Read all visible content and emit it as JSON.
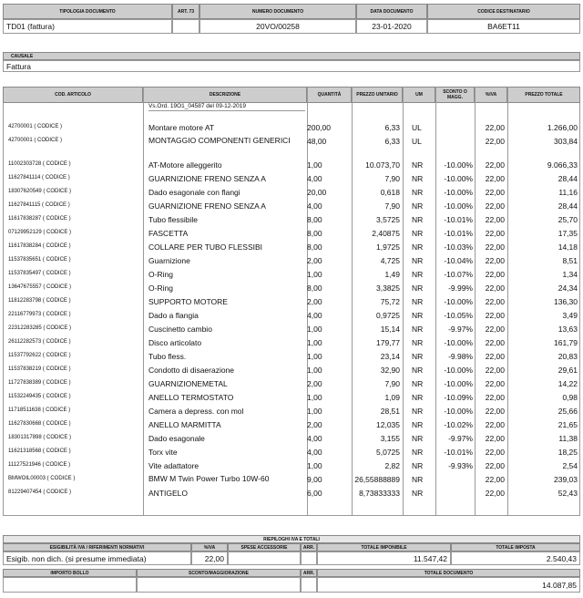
{
  "top_headers": {
    "tipologia": "TIPOLOGIA DOCUMENTO",
    "art": "ART. 73",
    "numero": "NUMERO DOCUMENTO",
    "data": "DATA DOCUMENTO",
    "codice_dest": "CODICE DESTINATARIO"
  },
  "top_values": {
    "tipologia": "TD01 (fattura)",
    "art": "",
    "numero": "20VO/00258",
    "data": "23-01-2020",
    "codice_dest": "BA6ET11"
  },
  "causale": {
    "label": "CAUSALE",
    "value": "Fattura"
  },
  "items_headers": {
    "cod": "COD. ARTICOLO",
    "descr": "DESCRIZIONE",
    "qty": "QUANTITÀ",
    "prezzo": "PREZZO UNITARIO",
    "um": "UM",
    "sconto": "SCONTO O MAGG.",
    "iva": "%IVA",
    "totale": "PREZZO TOTALE"
  },
  "order_ref": "Vs.Ord. 19O1_04587 del 09-12-2019",
  "items": [
    {
      "code": "42700001 ( CODICE )",
      "desc": "Montare motore AT",
      "qty": "200,00",
      "price": "6,33",
      "um": "UL",
      "disc": "",
      "iva": "22,00",
      "total": "1.266,00"
    },
    {
      "code": "42700001 ( CODICE )",
      "desc": "MONTAGGIO COMPONENTI GENERICI",
      "qty": "48,00",
      "price": "6,33",
      "um": "UL",
      "disc": "",
      "iva": "22,00",
      "total": "303,84"
    },
    {
      "code": "11002303728 ( CODICE )",
      "desc": "AT-Motore alleggerito",
      "qty": "1,00",
      "price": "10.073,70",
      "um": "NR",
      "disc": "-10.00%",
      "iva": "22,00",
      "total": "9.066,33"
    },
    {
      "code": "11627841114 ( CODICE )",
      "desc": "GUARNIZIONE FRENO SENZA A",
      "qty": "4,00",
      "price": "7,90",
      "um": "NR",
      "disc": "-10.00%",
      "iva": "22,00",
      "total": "28,44"
    },
    {
      "code": "18307620549 ( CODICE )",
      "desc": "Dado esagonale con flangi",
      "qty": "20,00",
      "price": "0,618",
      "um": "NR",
      "disc": "-10.00%",
      "iva": "22,00",
      "total": "11,16"
    },
    {
      "code": "11627841115 ( CODICE )",
      "desc": "GUARNIZIONE FRENO SENZA A",
      "qty": "4,00",
      "price": "7,90",
      "um": "NR",
      "disc": "-10.00%",
      "iva": "22,00",
      "total": "28,44"
    },
    {
      "code": "11617838287 ( CODICE )",
      "desc": "Tubo flessibile",
      "qty": "8,00",
      "price": "3,5725",
      "um": "NR",
      "disc": "-10.01%",
      "iva": "22,00",
      "total": "25,70"
    },
    {
      "code": "07129952129 ( CODICE )",
      "desc": "FASCETTA",
      "qty": "8,00",
      "price": "2,40875",
      "um": "NR",
      "disc": "-10.01%",
      "iva": "22,00",
      "total": "17,35"
    },
    {
      "code": "11617838284 ( CODICE )",
      "desc": "COLLARE PER TUBO FLESSIBI",
      "qty": "8,00",
      "price": "1,9725",
      "um": "NR",
      "disc": "-10.03%",
      "iva": "22,00",
      "total": "14,18"
    },
    {
      "code": "11537835651 ( CODICE )",
      "desc": "Guarnizione",
      "qty": "2,00",
      "price": "4,725",
      "um": "NR",
      "disc": "-10.04%",
      "iva": "22,00",
      "total": "8,51"
    },
    {
      "code": "11537835497 ( CODICE )",
      "desc": "O-Ring",
      "qty": "1,00",
      "price": "1,49",
      "um": "NR",
      "disc": "-10.07%",
      "iva": "22,00",
      "total": "1,34"
    },
    {
      "code": "13647675557 ( CODICE )",
      "desc": "O-Ring",
      "qty": "8,00",
      "price": "3,3825",
      "um": "NR",
      "disc": "-9.99%",
      "iva": "22,00",
      "total": "24,34"
    },
    {
      "code": "11812283798 ( CODICE )",
      "desc": "SUPPORTO MOTORE",
      "qty": "2,00",
      "price": "75,72",
      "um": "NR",
      "disc": "-10.00%",
      "iva": "22,00",
      "total": "136,30"
    },
    {
      "code": "22116779973 ( CODICE )",
      "desc": "Dado a flangia",
      "qty": "4,00",
      "price": "0,9725",
      "um": "NR",
      "disc": "-10.05%",
      "iva": "22,00",
      "total": "3,49"
    },
    {
      "code": "22312283285 ( CODICE )",
      "desc": "Cuscinetto cambio",
      "qty": "1,00",
      "price": "15,14",
      "um": "NR",
      "disc": "-9.97%",
      "iva": "22,00",
      "total": "13,63"
    },
    {
      "code": "26112282573 ( CODICE )",
      "desc": "Disco articolato",
      "qty": "1,00",
      "price": "179,77",
      "um": "NR",
      "disc": "-10.00%",
      "iva": "22,00",
      "total": "161,79"
    },
    {
      "code": "11537792622 ( CODICE )",
      "desc": "Tubo fless.",
      "qty": "1,00",
      "price": "23,14",
      "um": "NR",
      "disc": "-9.98%",
      "iva": "22,00",
      "total": "20,83"
    },
    {
      "code": "11537838219 ( CODICE )",
      "desc": "Condotto di disaerazione",
      "qty": "1,00",
      "price": "32,90",
      "um": "NR",
      "disc": "-10.00%",
      "iva": "22,00",
      "total": "29,61"
    },
    {
      "code": "11727838389 ( CODICE )",
      "desc": "GUARNIZIONEMETAL",
      "qty": "2,00",
      "price": "7,90",
      "um": "NR",
      "disc": "-10.00%",
      "iva": "22,00",
      "total": "14,22"
    },
    {
      "code": "11532249435 ( CODICE )",
      "desc": "ANELLO TERMOSTATO",
      "qty": "1,00",
      "price": "1,09",
      "um": "NR",
      "disc": "-10.09%",
      "iva": "22,00",
      "total": "0,98"
    },
    {
      "code": "11718511638 ( CODICE )",
      "desc": "Camera a depress. con mol",
      "qty": "1,00",
      "price": "28,51",
      "um": "NR",
      "disc": "-10.00%",
      "iva": "22,00",
      "total": "25,66"
    },
    {
      "code": "11627830668 ( CODICE )",
      "desc": "ANELLO MARMITTA",
      "qty": "2,00",
      "price": "12,035",
      "um": "NR",
      "disc": "-10.02%",
      "iva": "22,00",
      "total": "21,65"
    },
    {
      "code": "18301317898 ( CODICE )",
      "desc": "Dado esagonale",
      "qty": "4,00",
      "price": "3,155",
      "um": "NR",
      "disc": "-9.97%",
      "iva": "22,00",
      "total": "11,38"
    },
    {
      "code": "11621318568 ( CODICE )",
      "desc": "Torx vite",
      "qty": "4,00",
      "price": "5,0725",
      "um": "NR",
      "disc": "-10.01%",
      "iva": "22,00",
      "total": "18,25"
    },
    {
      "code": "11127521946 ( CODICE )",
      "desc": "Vite adattatore",
      "qty": "1,00",
      "price": "2,82",
      "um": "NR",
      "disc": "-9.93%",
      "iva": "22,00",
      "total": "2,54"
    },
    {
      "code": "BMWOIL00003 ( CODICE )",
      "desc": "BMW M Twin Power Turbo 10W-60",
      "qty": "9,00",
      "price": "26,55888889",
      "um": "NR",
      "disc": "",
      "iva": "22,00",
      "total": "239,03"
    },
    {
      "code": "81229407454 ( CODICE )",
      "desc": "ANTIGELO",
      "qty": "6,00",
      "price": "8,73833333",
      "um": "NR",
      "disc": "",
      "iva": "22,00",
      "total": "52,43"
    }
  ],
  "summary": {
    "title": "RIEPILOGHI IVA E TOTALI",
    "headers": {
      "esig": "ESIGIBILITÀ IVA / RIFERIMENTI NORMATIVI",
      "iva": "%IVA",
      "spese": "SPESE ACCESSORIE",
      "arr": "ARR.",
      "imponibile": "TOTALE IMPONIBILE",
      "imposta": "TOTALE IMPOSTA"
    },
    "values": {
      "esig": "Esigib. non dich. (si presume immediata)",
      "iva": "22,00",
      "spese": "",
      "arr": "",
      "imponibile": "11.547,42",
      "imposta": "2.540,43"
    },
    "headers2": {
      "bollo": "IMPORTO BOLLO",
      "sconto": "SCONTO/MAGGIORAZIONE",
      "arr": "ARR.",
      "totale_doc": "TOTALE DOCUMENTO"
    },
    "values2": {
      "bollo": "",
      "sconto": "",
      "arr": "",
      "totale_doc": "14.087,85"
    }
  }
}
